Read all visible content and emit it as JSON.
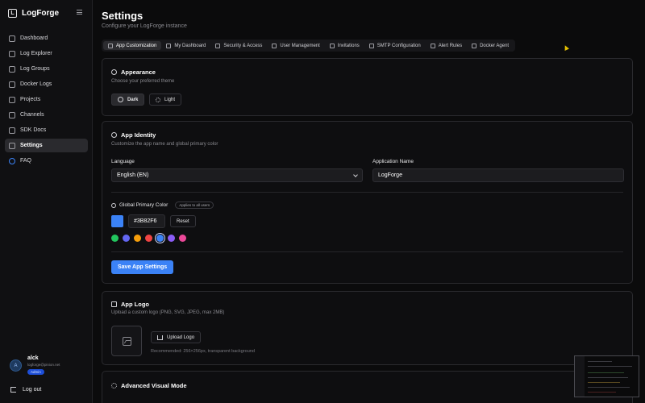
{
  "brand": {
    "name": "LogForge",
    "logo_letter": "L"
  },
  "sidebar": {
    "items": [
      {
        "label": "Dashboard",
        "icon": "grid-icon"
      },
      {
        "label": "Log Explorer",
        "icon": "search-icon"
      },
      {
        "label": "Log Groups",
        "icon": "layers-icon"
      },
      {
        "label": "Docker Logs",
        "icon": "docker-icon"
      },
      {
        "label": "Projects",
        "icon": "folder-icon"
      },
      {
        "label": "Channels",
        "icon": "broadcast-icon"
      },
      {
        "label": "SDK Docs",
        "icon": "book-icon"
      },
      {
        "label": "Settings",
        "icon": "gear-icon",
        "active": true
      },
      {
        "label": "FAQ",
        "icon": "help-circle-icon"
      }
    ]
  },
  "user": {
    "initial": "A",
    "name": "alck",
    "email": "logforge@pinion.net",
    "role": "Admin"
  },
  "logout_label": "Log out",
  "header": {
    "title": "Settings",
    "subtitle": "Configure your LogForge instance"
  },
  "tabs": [
    {
      "label": "App Customization",
      "icon": "image-icon",
      "active": true
    },
    {
      "label": "My Dashboard",
      "icon": "grid-icon"
    },
    {
      "label": "Security & Access",
      "icon": "shield-icon"
    },
    {
      "label": "User Management",
      "icon": "users-icon"
    },
    {
      "label": "Invitations",
      "icon": "user-plus-icon"
    },
    {
      "label": "SMTP Configuration",
      "icon": "mail-icon"
    },
    {
      "label": "Alert Rules",
      "icon": "bell-icon"
    },
    {
      "label": "Docker Agent",
      "icon": "docker-icon"
    }
  ],
  "appearance": {
    "title": "Appearance",
    "desc": "Choose your preferred theme",
    "dark_label": "Dark",
    "light_label": "Light"
  },
  "identity": {
    "title": "App Identity",
    "desc": "Customize the app name and global primary color",
    "language_label": "Language",
    "language_value": "English (EN)",
    "appname_label": "Application Name",
    "appname_value": "LogForge",
    "color_label": "Global Primary Color",
    "applies_badge": "Applies to all users",
    "hex_value": "#3B82F6",
    "reset_label": "Reset",
    "save_label": "Save App Settings",
    "primary_color": "#3b82f6",
    "presets": [
      "#22c55e",
      "#6366f1",
      "#f59e0b",
      "#ef4444",
      "#3b82f6",
      "#8b5cf6",
      "#ec4899"
    ]
  },
  "logo": {
    "title": "App Logo",
    "desc": "Upload a custom logo (PNG, SVG, JPEG, max 2MB)",
    "upload_label": "Upload Logo",
    "hint": "Recommended: 256×256px, transparent background"
  },
  "advanced": {
    "title": "Advanced Visual Mode"
  }
}
